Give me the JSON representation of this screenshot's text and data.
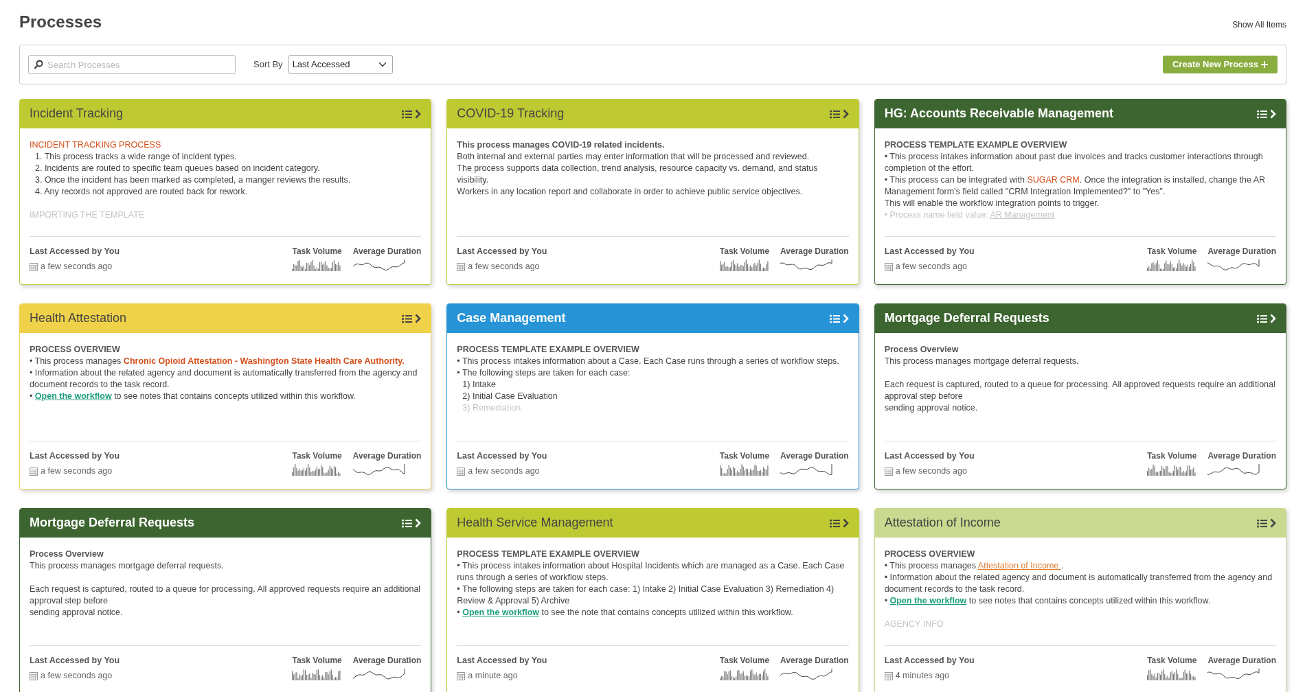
{
  "page": {
    "title": "Processes",
    "show_all": "Show All Items"
  },
  "toolbar": {
    "search_placeholder": "Search Processes",
    "sort_label": "Sort By",
    "sort_value": "Last Accessed",
    "create_button": "Create New Process"
  },
  "cards": [
    {
      "title": "Incident Tracking",
      "color": "#bfca33",
      "lines": [
        {
          "kind": "accent_heading",
          "text": "INCIDENT TRACKING PROCESS"
        },
        {
          "kind": "item",
          "text": "1. This process tracks a wide range of incident types."
        },
        {
          "kind": "item",
          "text": "2. Incidents are routed to specific team queues based on incident category."
        },
        {
          "kind": "item",
          "text": "3. Once the incident has been marked as completed,  a manger reviews the results."
        },
        {
          "kind": "item",
          "text": "4. Any records not approved are routed back for rework."
        },
        {
          "kind": "spacer"
        },
        {
          "kind": "faded",
          "text": "IMPORTING THE TEMPLATE"
        }
      ],
      "footer": {
        "accessed_label": "Last Accessed by You",
        "accessed_time": "a few seconds ago",
        "volume_label": "Task Volume",
        "duration_label": "Average Duration"
      }
    },
    {
      "title": "COVID-19 Tracking",
      "color": "#bfca33",
      "lines": [
        {
          "kind": "heading",
          "text": "This process manages COVID-19 related incidents."
        },
        {
          "kind": "text",
          "text": "Both internal and external parties may enter information that will be processed and reviewed."
        },
        {
          "kind": "text",
          "text": "The process supports data collection, trend analysis, resource capacity vs. demand, and status visibility."
        },
        {
          "kind": "text",
          "text": "Workers in any location report and collaborate in order to achieve public service objectives."
        }
      ],
      "footer": {
        "accessed_label": "Last Accessed by You",
        "accessed_time": "a few seconds ago",
        "volume_label": "Task Volume",
        "duration_label": "Average Duration"
      }
    },
    {
      "title": "HG: Accounts Receivable Management",
      "color": "#3d6530",
      "lines": [
        {
          "kind": "heading",
          "text": "PROCESS TEMPLATE EXAMPLE OVERVIEW"
        },
        {
          "kind": "text",
          "text": "• This process intakes information about past due invoices and tracks customer interactions through completion of the effort."
        },
        {
          "kind": "text",
          "parts": [
            {
              "kind": "plain",
              "text": "• This process can be integrated with "
            },
            {
              "kind": "accent",
              "text": "SUGAR CRM"
            },
            {
              "kind": "plain",
              "text": ". Once the integration is installed, change the AR Management form's field called \"CRM Integration Implemented?\" to \"Yes\"."
            }
          ]
        },
        {
          "kind": "text",
          "text": "This will enable the workflow integration points to trigger."
        },
        {
          "kind": "faded",
          "parts": [
            {
              "kind": "plain",
              "text": "• Process name field value: "
            },
            {
              "kind": "link",
              "text": "AR Management"
            }
          ]
        }
      ],
      "footer": {
        "accessed_label": "Last Accessed by You",
        "accessed_time": "a few seconds ago",
        "volume_label": "Task Volume",
        "duration_label": "Average Duration"
      }
    },
    {
      "title": "Health Attestation",
      "color": "#f0d24a",
      "lines": [
        {
          "kind": "heading",
          "text": "PROCESS OVERVIEW"
        },
        {
          "kind": "text",
          "parts": [
            {
              "kind": "plain",
              "text": "• This process manages "
            },
            {
              "kind": "accent_bold",
              "text": "Chronic Opioid Attestation - Washington State Health Care Authority"
            },
            {
              "kind": "accent_bold",
              "text": "."
            }
          ]
        },
        {
          "kind": "text",
          "text": "• Information about the related agency and document is automatically transferred from the agency and document records to the task record."
        },
        {
          "kind": "text",
          "parts": [
            {
              "kind": "plain",
              "text": "• "
            },
            {
              "kind": "link",
              "text": "Open the workflow"
            },
            {
              "kind": "plain",
              "text": " to see notes that contains concepts utilized within this workflow."
            }
          ]
        }
      ],
      "footer": {
        "accessed_label": "Last Accessed by You",
        "accessed_time": "a few seconds ago",
        "volume_label": "Task Volume",
        "duration_label": "Average Duration"
      }
    },
    {
      "title": "Case Management",
      "color": "#2694d6",
      "lines": [
        {
          "kind": "heading",
          "text": "PROCESS TEMPLATE EXAMPLE OVERVIEW"
        },
        {
          "kind": "text",
          "text": "• This process intakes information about a Case. Each Case runs through a series of workflow steps."
        },
        {
          "kind": "text",
          "text": "• The following steps are taken for each case:"
        },
        {
          "kind": "item",
          "text": "1) Intake"
        },
        {
          "kind": "item",
          "text": "2) Initial Case Evaluation"
        },
        {
          "kind": "faded_item",
          "text": "3) Remediation"
        }
      ],
      "footer": {
        "accessed_label": "Last Accessed by You",
        "accessed_time": "a few seconds ago",
        "volume_label": "Task Volume",
        "duration_label": "Average Duration"
      }
    },
    {
      "title": "Mortgage Deferral Requests",
      "color": "#3d6530",
      "lines": [
        {
          "kind": "heading",
          "text": "Process Overview"
        },
        {
          "kind": "text",
          "text": "This process manages mortgage deferral requests."
        },
        {
          "kind": "spacer"
        },
        {
          "kind": "text",
          "text": "Each request is captured, routed to a queue for processing. All approved requests require an additional approval step before"
        },
        {
          "kind": "text",
          "text": "sending approval notice."
        }
      ],
      "footer": {
        "accessed_label": "Last Accessed by You",
        "accessed_time": "a few seconds ago",
        "volume_label": "Task Volume",
        "duration_label": "Average Duration"
      }
    },
    {
      "title": "Mortgage Deferral Requests",
      "color": "#3d6530",
      "lines": [
        {
          "kind": "heading",
          "text": "Process Overview"
        },
        {
          "kind": "text",
          "text": "This process manages mortgage deferral requests."
        },
        {
          "kind": "spacer"
        },
        {
          "kind": "text",
          "text": "Each request is captured, routed to a queue for processing. All approved requests require an additional approval step before"
        },
        {
          "kind": "text",
          "text": "sending approval notice."
        }
      ],
      "footer": {
        "accessed_label": "Last Accessed by You",
        "accessed_time": "a few seconds ago",
        "volume_label": "Task Volume",
        "duration_label": "Average Duration"
      }
    },
    {
      "title": "Health Service Management",
      "color": "#bfca33",
      "lines": [
        {
          "kind": "heading",
          "text": "PROCESS TEMPLATE EXAMPLE OVERVIEW"
        },
        {
          "kind": "text",
          "text": "• This process intakes information about Hospital Incidents which are managed as a Case. Each Case runs through a series of workflow steps."
        },
        {
          "kind": "text",
          "text": "• The following steps are taken for each case: 1) Intake 2) Initial Case Evaluation 3) Remediation 4) Review & Approval 5) Archive"
        },
        {
          "kind": "text",
          "parts": [
            {
              "kind": "plain",
              "text": "• "
            },
            {
              "kind": "link",
              "text": "Open the workflow"
            },
            {
              "kind": "plain",
              "text": " to see the note that contains concepts utilized within this workflow."
            }
          ]
        }
      ],
      "footer": {
        "accessed_label": "Last Accessed by You",
        "accessed_time": "a minute ago",
        "volume_label": "Task Volume",
        "duration_label": "Average Duration"
      }
    },
    {
      "title": "Attestation of Income",
      "color": "#c9d98f",
      "lines": [
        {
          "kind": "heading",
          "text": "PROCESS OVERVIEW"
        },
        {
          "kind": "text",
          "parts": [
            {
              "kind": "plain",
              "text": "• This process manages "
            },
            {
              "kind": "accent_link",
              "text": "Attestation of Income "
            },
            {
              "kind": "plain",
              "text": "."
            }
          ]
        },
        {
          "kind": "text",
          "text": "• Information about the related agency and document is automatically transferred from the agency and document records to the task record."
        },
        {
          "kind": "text",
          "parts": [
            {
              "kind": "plain",
              "text": "• "
            },
            {
              "kind": "link",
              "text": "Open the workflow"
            },
            {
              "kind": "plain",
              "text": " to see notes that contains concepts utilized within this workflow."
            }
          ]
        },
        {
          "kind": "spacer"
        },
        {
          "kind": "faded",
          "text": "AGENCY INFO"
        }
      ],
      "footer": {
        "accessed_label": "Last Accessed by You",
        "accessed_time": "4 minutes ago",
        "volume_label": "Task Volume",
        "duration_label": "Average Duration"
      }
    }
  ]
}
